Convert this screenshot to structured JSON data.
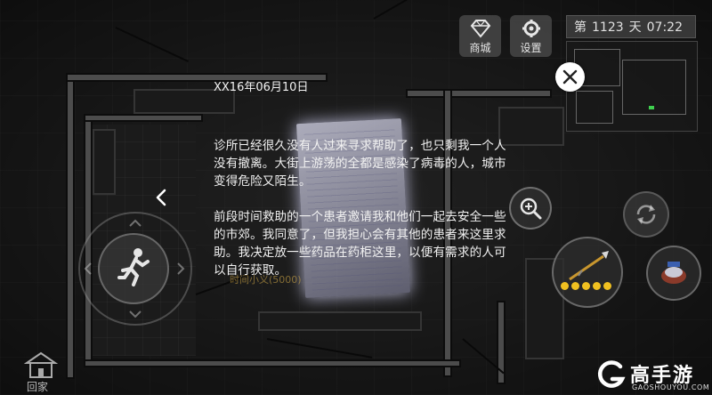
{
  "hud": {
    "shop_label": "商城",
    "shop_icon": "diamond-icon",
    "settings_label": "设置",
    "settings_icon": "gear-icon",
    "day_prefix": "第",
    "day_number": "1123",
    "day_suffix": "天",
    "clock": "07:22"
  },
  "note": {
    "date": "XX16年06月10日",
    "paragraph1": "诊所已经很久没有人过来寻求帮助了，也只剩我一个人没有撤离。大街上游荡的全都是感染了病毒的人，城市变得危险又陌生。",
    "paragraph2": "前段时间救助的一个患者邀请我和他们一起去安全一些的市郊。我同意了，但我担心会有其他的患者来这里求助。我决定放一些药品在药柜这里，以便有需求的人可以自行获取。",
    "close_icon": "close-icon",
    "prev_icon": "chevron-left-icon"
  },
  "player": {
    "name_tag": "时间小义(5000)"
  },
  "controls": {
    "home_label": "回家",
    "run_icon": "running-man-icon",
    "search_icon": "magnifier-plus-icon",
    "swap_icon": "swap-arrows-icon",
    "weapon_icon": "spear-icon",
    "weapon_stars": 5,
    "item_icon": "item-icon"
  },
  "watermark": {
    "brand": "高手游",
    "domain": "GAOSHOUYOU.COM"
  },
  "colors": {
    "star": "#f0c020",
    "minimap_player": "#3fd04f",
    "name_tag": "#d9ae47"
  }
}
